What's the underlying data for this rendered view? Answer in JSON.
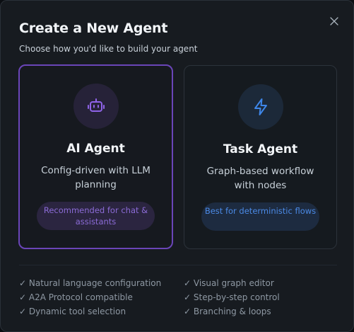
{
  "dialog": {
    "title": "Create a New Agent",
    "subtitle": "Choose how you'd like to build your agent",
    "close_icon": "close-icon"
  },
  "cards": {
    "ai": {
      "title": "AI Agent",
      "description": "Config-driven with LLM planning",
      "badge": "Recommended for chat & assistants",
      "icon": "robot-icon",
      "accent": "#6a45b8",
      "selected": true
    },
    "task": {
      "title": "Task Agent",
      "description": "Graph-based workflow with nodes",
      "badge": "Best for deterministic flows",
      "icon": "lightning-bolt-icon",
      "accent": "#4b8ae6"
    }
  },
  "features": {
    "ai": [
      "✓ Natural language configuration",
      "✓ A2A Protocol compatible",
      "✓ Dynamic tool selection"
    ],
    "task": [
      "✓ Visual graph editor",
      "✓ Step-by-step control",
      "✓ Branching & loops"
    ]
  }
}
